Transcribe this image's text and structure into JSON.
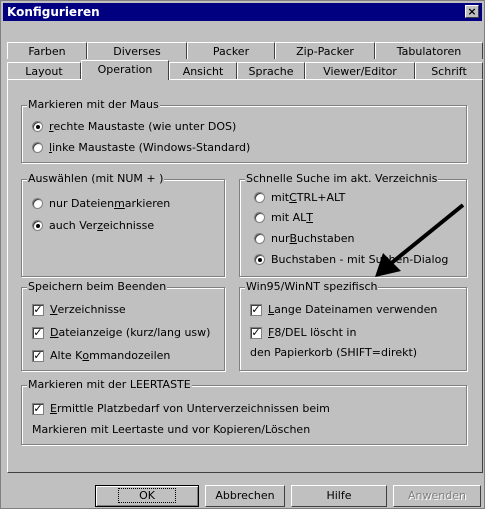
{
  "window": {
    "title": "Konfigurieren",
    "close_label": "×"
  },
  "tabs_row1": [
    "Farben",
    "Diverses",
    "Packer",
    "Zip-Packer",
    "Tabulatoren"
  ],
  "tabs_row2": [
    "Layout",
    "Operation",
    "Ansicht",
    "Sprache",
    "Viewer/Editor",
    "Schrift"
  ],
  "active_tab": "Operation",
  "mouse_group": {
    "legend": "Markieren mit der Maus",
    "options": [
      {
        "pre": "",
        "ul": "r",
        "post": "echte Maustaste (wie unter DOS)",
        "selected": true
      },
      {
        "pre": "",
        "ul": "l",
        "post": "inke Maustaste (Windows-Standard)",
        "selected": false
      }
    ]
  },
  "num_group": {
    "legend": "Auswählen (mit NUM + )",
    "options": [
      {
        "pre": "nur Dateien ",
        "ul": "m",
        "post": "arkieren",
        "selected": false
      },
      {
        "pre": "auch Ver",
        "ul": "z",
        "post": "eichnisse",
        "selected": true
      }
    ]
  },
  "search_group": {
    "legend": "Schnelle Suche im akt. Verzeichnis",
    "options": [
      {
        "pre": "mit ",
        "ul": "C",
        "post": "TRL+ALT",
        "selected": false
      },
      {
        "pre": "mit AL",
        "ul": "T",
        "post": "",
        "selected": false
      },
      {
        "pre": "nur ",
        "ul": "B",
        "post": "uchstaben",
        "selected": false
      },
      {
        "pre": "Buchstaben - mit Suchen-Dialog",
        "ul": "",
        "post": "",
        "selected": true
      }
    ]
  },
  "save_group": {
    "legend": "Speichern beim Beenden",
    "options": [
      {
        "pre": "",
        "ul": "V",
        "post": "erzeichnisse",
        "checked": true
      },
      {
        "pre": "",
        "ul": "D",
        "post": "ateianzeige (kurz/lang usw)",
        "checked": true
      },
      {
        "pre": "Alte K",
        "ul": "o",
        "post": "mmandozeilen",
        "checked": true
      }
    ]
  },
  "win_group": {
    "legend": "Win95/WinNT spezifisch",
    "options": [
      {
        "pre": "",
        "ul": "L",
        "post": "ange Dateinamen verwenden",
        "checked": true
      },
      {
        "pre": "",
        "ul": "F",
        "post": "8/DEL löscht in",
        "checked": true
      }
    ],
    "extra_line": "den Papierkorb (SHIFT=direkt)"
  },
  "space_group": {
    "legend": "Markieren mit der LEERTASTE",
    "option": {
      "pre": "",
      "ul": "E",
      "post": "rmittle Platzbedarf von Unterverzeichnissen beim",
      "checked": true
    },
    "extra_line": "Markieren mit Leertaste und vor Kopieren/Löschen"
  },
  "buttons": {
    "ok": "OK",
    "cancel": "Abbrechen",
    "help": "Hilfe",
    "apply": "Anwenden"
  },
  "check_glyph": "✓"
}
